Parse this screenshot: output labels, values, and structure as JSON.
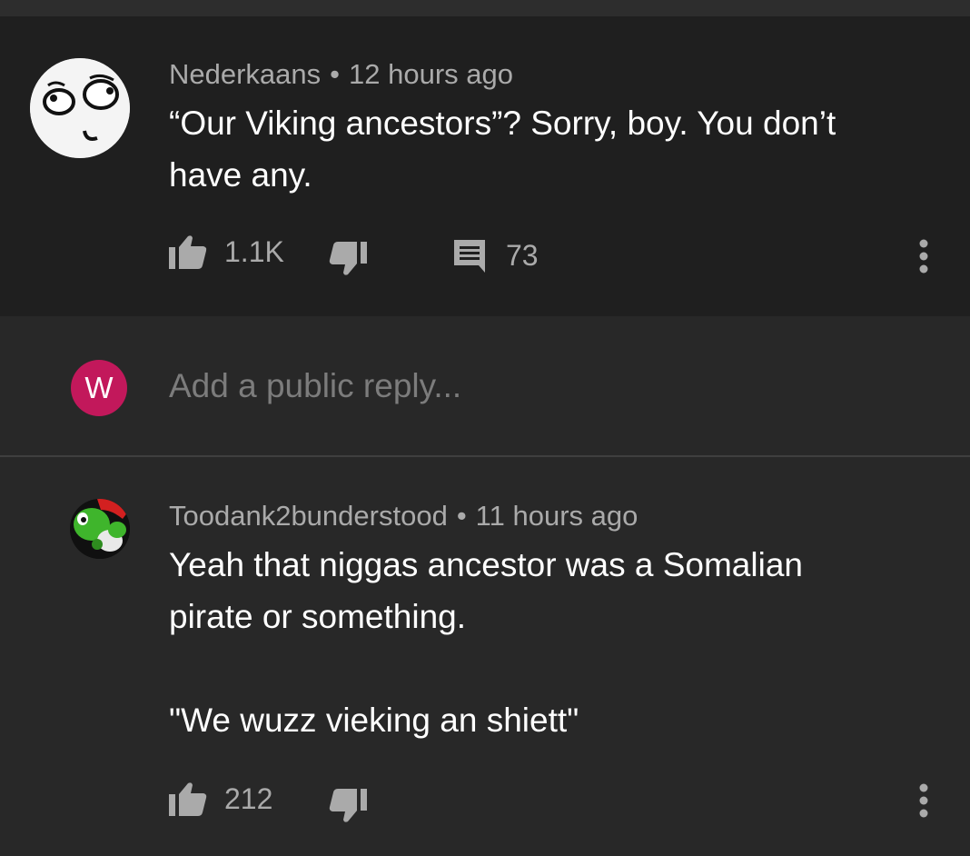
{
  "comments": [
    {
      "author": "Nederkaans",
      "time": "12 hours ago",
      "text_line1": "“Our Viking ancestors”? Sorry, boy. You don’t",
      "text_line2": "have any.",
      "likes": "1.1K",
      "replies": "73",
      "avatar_icon": "rage-face-avatar"
    },
    {
      "author": "Toodank2bunderstood",
      "time": "11 hours ago",
      "text_line1": "Yeah that niggas ancestor was a Somalian",
      "text_line2": "pirate or something.",
      "text_line3": "\"We wuzz vieking an shiett\"",
      "likes": "212",
      "avatar_icon": "yoshi-avatar"
    }
  ],
  "reply_box": {
    "avatar_letter": "W",
    "placeholder": "Add a public reply..."
  },
  "separator": "•",
  "colors": {
    "background": "#282828",
    "highlight_comment_bg": "#1f1f1f",
    "meta_text": "#aaaaaa",
    "user_avatar": "#c2185b"
  }
}
